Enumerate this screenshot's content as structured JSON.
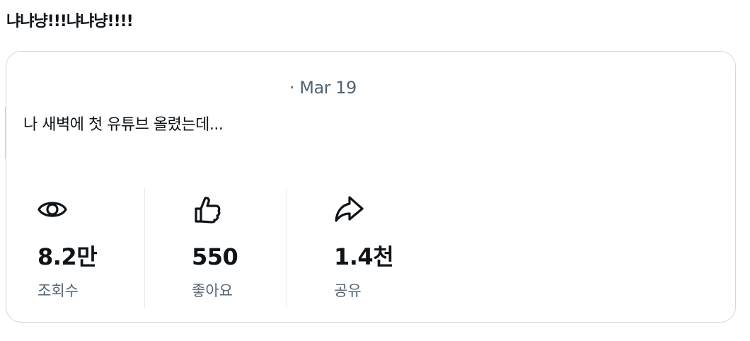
{
  "heading": "냐냐냥!!!냐냐냥!!!!",
  "card": {
    "date": "· Mar 19",
    "text": "나 새벽에 첫 유튜브 올렸는데...",
    "stats": [
      {
        "icon": "eye-icon",
        "value": "8.2만",
        "label": "조회수"
      },
      {
        "icon": "thumbs-up-icon",
        "value": "550",
        "label": "좋아요"
      },
      {
        "icon": "share-arrow-icon",
        "value": "1.4천",
        "label": "공유"
      }
    ]
  }
}
